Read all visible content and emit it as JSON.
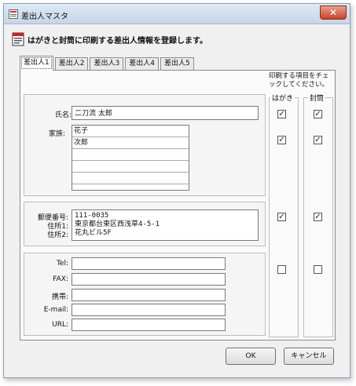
{
  "window": {
    "title": "差出人マスタ",
    "close_glyph": "✕"
  },
  "header": {
    "text": "はがきと封筒に印刷する差出人情報を登録します。"
  },
  "tabs": [
    "差出人1",
    "差出人2",
    "差出人3",
    "差出人4",
    "差出人5"
  ],
  "name_section": {
    "name_label": "氏名:",
    "name_value": "二刀流 太郎",
    "family_label": "家族:",
    "family_rows": [
      "花子",
      "次郎",
      "",
      "",
      "",
      ""
    ]
  },
  "address_section": {
    "postal_label": "郵便番号:",
    "addr1_label": "住所1:",
    "addr2_label": "住所2:",
    "lines": [
      "111-0035",
      "東京都台東区西浅草4-5-1",
      "花丸ビル5F"
    ]
  },
  "contact_section": {
    "fields": [
      {
        "label": "Tel:",
        "value": ""
      },
      {
        "label": "FAX:",
        "value": ""
      },
      {
        "label": "携帯:",
        "value": ""
      },
      {
        "label": "E-mail:",
        "value": ""
      },
      {
        "label": "URL:",
        "value": ""
      }
    ]
  },
  "print_columns": {
    "header_line1": "印刷する項目をチェ",
    "header_line2": "ックしてください。",
    "postcard_label": "はがき",
    "envelope_label": "封筒",
    "check_glyph": "✓",
    "rows": [
      {
        "postcard": true,
        "envelope": true
      },
      {
        "postcard": true,
        "envelope": true
      },
      {
        "postcard": true,
        "envelope": true
      },
      {
        "postcard": false,
        "envelope": false
      }
    ]
  },
  "buttons": {
    "ok": "OK",
    "cancel": "キャンセル"
  }
}
